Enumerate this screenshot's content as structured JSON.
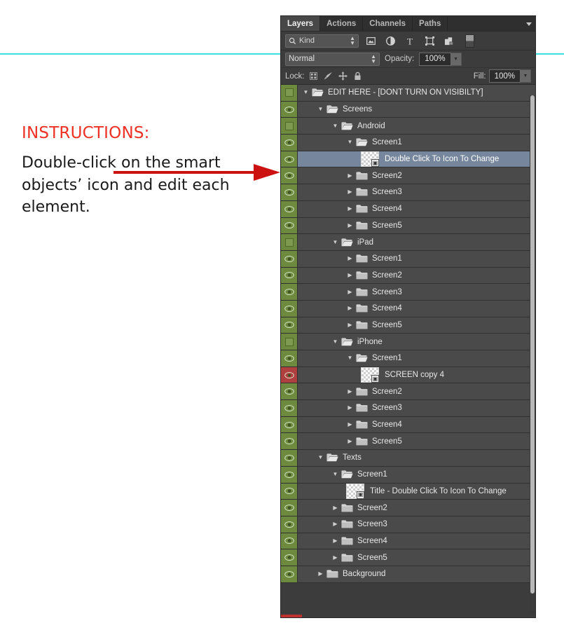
{
  "annotation": {
    "title": "INSTRUCTIONS:",
    "body": "Double-click on the smart objects’ icon and edit each element.",
    "title_color": "#ee3124",
    "arrow_color": "#cc1111",
    "guide_color": "#3fe0e0"
  },
  "panel": {
    "tabs": [
      {
        "label": "Layers",
        "active": true
      },
      {
        "label": "Actions",
        "active": false
      },
      {
        "label": "Channels",
        "active": false
      },
      {
        "label": "Paths",
        "active": false
      }
    ],
    "panel_menu_icon": "panel-menu-icon",
    "filter": {
      "search_icon": "search-icon",
      "kind_value": "Kind",
      "stepper_icon": "updown-stepper-icon",
      "type_filters": [
        {
          "name": "filter-pixel-icon",
          "glyph": "image"
        },
        {
          "name": "filter-adjustment-icon",
          "glyph": "adjustment"
        },
        {
          "name": "filter-type-icon",
          "glyph": "T"
        },
        {
          "name": "filter-shape-icon",
          "glyph": "shape"
        },
        {
          "name": "filter-smart-object-icon",
          "glyph": "smartobject"
        }
      ],
      "toggle_name": "filter-enable-toggle"
    },
    "blend": {
      "mode_value": "Normal",
      "opacity_label": "Opacity:",
      "opacity_value": "100%",
      "fill_label": "Fill:",
      "fill_value": "100%"
    },
    "lock": {
      "label": "Lock:",
      "icons": [
        "lock-transparent-pixels-icon",
        "lock-image-pixels-icon",
        "lock-position-icon",
        "lock-all-icon"
      ]
    },
    "colors": {
      "panel_bg": "#3c3c3c",
      "row_bg": "#4a4a4a",
      "row_selected": "#76869c",
      "visibility_on": "#6d8a3f",
      "visibility_flagged": "#b04040"
    },
    "layers": [
      {
        "name": "EDIT HERE - [DONT TURN ON VISIBILTY]",
        "indent": 0,
        "type": "group",
        "expanded": true,
        "visible": false,
        "selected": false,
        "vis_color": "green"
      },
      {
        "name": "Screens",
        "indent": 1,
        "type": "group",
        "expanded": true,
        "visible": true,
        "selected": false,
        "vis_color": "green"
      },
      {
        "name": "Android",
        "indent": 2,
        "type": "group",
        "expanded": true,
        "visible": false,
        "selected": false,
        "vis_color": "green"
      },
      {
        "name": "Screen1",
        "indent": 3,
        "type": "group",
        "expanded": true,
        "visible": true,
        "selected": false,
        "vis_color": "green"
      },
      {
        "name": "Double Click To Icon To Change",
        "indent": 4,
        "type": "smart-object",
        "expanded": null,
        "visible": true,
        "selected": true,
        "vis_color": "green"
      },
      {
        "name": "Screen2",
        "indent": 3,
        "type": "group",
        "expanded": false,
        "visible": true,
        "selected": false,
        "vis_color": "green"
      },
      {
        "name": "Screen3",
        "indent": 3,
        "type": "group",
        "expanded": false,
        "visible": true,
        "selected": false,
        "vis_color": "green"
      },
      {
        "name": "Screen4",
        "indent": 3,
        "type": "group",
        "expanded": false,
        "visible": true,
        "selected": false,
        "vis_color": "green"
      },
      {
        "name": "Screen5",
        "indent": 3,
        "type": "group",
        "expanded": false,
        "visible": true,
        "selected": false,
        "vis_color": "green"
      },
      {
        "name": "iPad",
        "indent": 2,
        "type": "group",
        "expanded": true,
        "visible": false,
        "selected": false,
        "vis_color": "green"
      },
      {
        "name": "Screen1",
        "indent": 3,
        "type": "group",
        "expanded": false,
        "visible": true,
        "selected": false,
        "vis_color": "green"
      },
      {
        "name": "Screen2",
        "indent": 3,
        "type": "group",
        "expanded": false,
        "visible": true,
        "selected": false,
        "vis_color": "green"
      },
      {
        "name": "Screen3",
        "indent": 3,
        "type": "group",
        "expanded": false,
        "visible": true,
        "selected": false,
        "vis_color": "green"
      },
      {
        "name": "Screen4",
        "indent": 3,
        "type": "group",
        "expanded": false,
        "visible": true,
        "selected": false,
        "vis_color": "green"
      },
      {
        "name": "Screen5",
        "indent": 3,
        "type": "group",
        "expanded": false,
        "visible": true,
        "selected": false,
        "vis_color": "green"
      },
      {
        "name": "iPhone",
        "indent": 2,
        "type": "group",
        "expanded": true,
        "visible": false,
        "selected": false,
        "vis_color": "green"
      },
      {
        "name": "Screen1",
        "indent": 3,
        "type": "group",
        "expanded": true,
        "visible": true,
        "selected": false,
        "vis_color": "green"
      },
      {
        "name": "SCREEN copy 4",
        "indent": 4,
        "type": "smart-object",
        "expanded": null,
        "visible": true,
        "selected": false,
        "vis_color": "red"
      },
      {
        "name": "Screen2",
        "indent": 3,
        "type": "group",
        "expanded": false,
        "visible": true,
        "selected": false,
        "vis_color": "green"
      },
      {
        "name": "Screen3",
        "indent": 3,
        "type": "group",
        "expanded": false,
        "visible": true,
        "selected": false,
        "vis_color": "green"
      },
      {
        "name": "Screen4",
        "indent": 3,
        "type": "group",
        "expanded": false,
        "visible": true,
        "selected": false,
        "vis_color": "green"
      },
      {
        "name": "Screen5",
        "indent": 3,
        "type": "group",
        "expanded": false,
        "visible": true,
        "selected": false,
        "vis_color": "green"
      },
      {
        "name": "Texts",
        "indent": 1,
        "type": "group",
        "expanded": true,
        "visible": true,
        "selected": false,
        "vis_color": "green"
      },
      {
        "name": "Screen1",
        "indent": 2,
        "type": "group",
        "expanded": true,
        "visible": true,
        "selected": false,
        "vis_color": "green"
      },
      {
        "name": "Title - Double Click To Icon To Change",
        "indent": 3,
        "type": "smart-object",
        "expanded": null,
        "visible": true,
        "selected": false,
        "vis_color": "green"
      },
      {
        "name": "Screen2",
        "indent": 2,
        "type": "group",
        "expanded": false,
        "visible": true,
        "selected": false,
        "vis_color": "green"
      },
      {
        "name": "Screen3",
        "indent": 2,
        "type": "group",
        "expanded": false,
        "visible": true,
        "selected": false,
        "vis_color": "green"
      },
      {
        "name": "Screen4",
        "indent": 2,
        "type": "group",
        "expanded": false,
        "visible": true,
        "selected": false,
        "vis_color": "green"
      },
      {
        "name": "Screen5",
        "indent": 2,
        "type": "group",
        "expanded": false,
        "visible": true,
        "selected": false,
        "vis_color": "green"
      },
      {
        "name": "Background",
        "indent": 1,
        "type": "group",
        "expanded": false,
        "visible": true,
        "selected": false,
        "vis_color": "green"
      }
    ]
  }
}
